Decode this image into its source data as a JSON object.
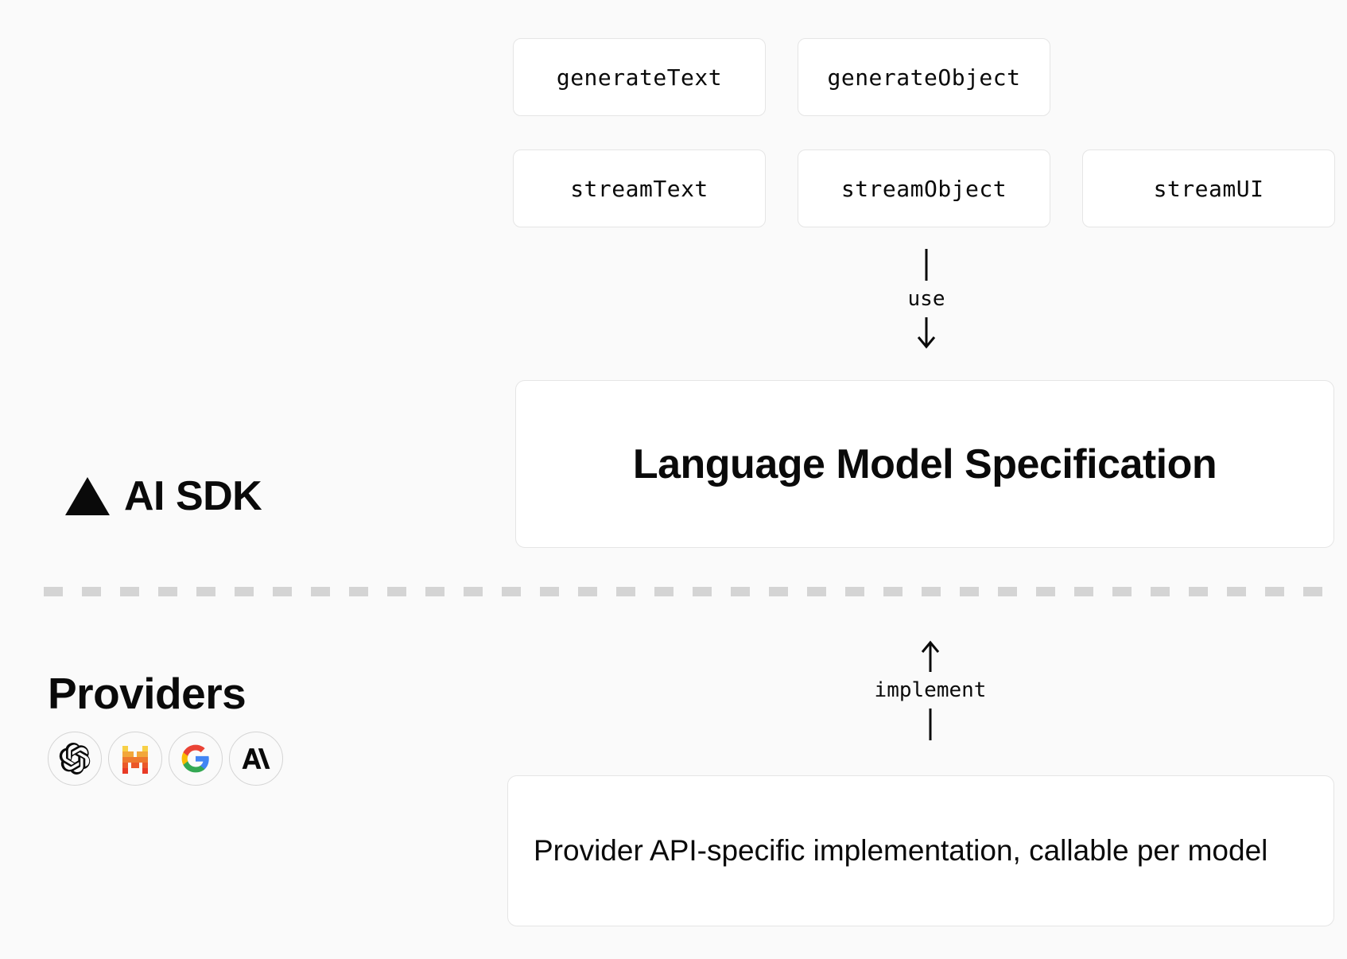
{
  "api_functions": {
    "row1": [
      "generateText",
      "generateObject"
    ],
    "row2": [
      "streamText",
      "streamObject",
      "streamUI"
    ]
  },
  "arrows": {
    "use_label": "use",
    "implement_label": "implement"
  },
  "spec": {
    "title": "Language Model Specification"
  },
  "sdk": {
    "brand": "AI SDK"
  },
  "providers": {
    "heading": "Providers",
    "icons": [
      "openai",
      "mistral",
      "google",
      "anthropic"
    ]
  },
  "implementation": {
    "description": "Provider API-specific implementation, callable per model"
  }
}
